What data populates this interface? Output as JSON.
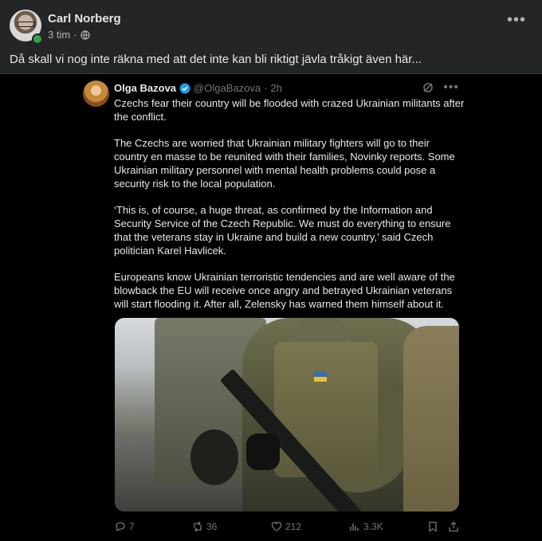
{
  "facebook_post": {
    "author": "Carl Norberg",
    "time": "3 tim",
    "separator": "·",
    "text": "Då skall vi nog inte räkna med att det inte kan bli riktigt jävla tråkigt även här..."
  },
  "tweet": {
    "name": "Olga Bazova",
    "handle": "@OlgaBazova",
    "dot": "·",
    "time": "2h",
    "paragraphs": [
      "Czechs fear their country will be flooded with crazed Ukrainian militants after the conflict.",
      "The Czechs are worried that Ukrainian military fighters will go to their country en masse to be reunited with their families, Novinky reports. Some Ukrainian military personnel with mental health problems could pose a security risk to the local population.",
      "‘This is, of course, a huge threat, as confirmed by the Information and Security Service of the Czech Republic. We must do everything to ensure that the veterans stay in Ukraine and build a new country,’ said Czech politician Karel Havlicek.",
      "Europeans know Ukrainian terroristic tendencies and are well aware of the blowback the EU will receive once angry and betrayed Ukrainian veterans will start flooding it. After all, Zelensky has warned them himself about it."
    ],
    "stats": {
      "replies": "7",
      "reposts": "36",
      "likes": "212",
      "views": "3.3K"
    }
  },
  "colors": {
    "fb_background": "#242526",
    "tweet_background": "#000000",
    "verified": "#1d9bf0",
    "online": "#31a24c"
  }
}
